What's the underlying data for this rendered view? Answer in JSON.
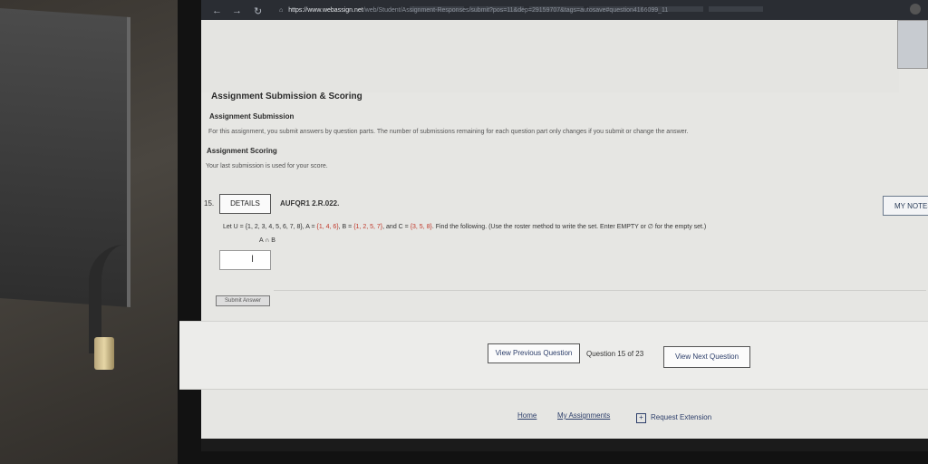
{
  "browser": {
    "url_domain": "https://www.webassign.net",
    "url_rest": "/web/Student/Assignment-Responses/submit?pos=11&dep=29159707&tags=autosave#question4166099_11"
  },
  "scoring": {
    "title": "Assignment Submission & Scoring",
    "submission_heading": "Assignment Submission",
    "submission_text": "For this assignment, you submit answers by question parts. The number of submissions remaining for each question part only changes if you submit or change the answer.",
    "scoring_heading": "Assignment Scoring",
    "scoring_text": "Your last submission is used for your score."
  },
  "question": {
    "number": "15.",
    "details_label": "DETAILS",
    "code": "AUFQR1 2.R.022.",
    "my_notes_label": "MY NOTES",
    "prompt_prefix": "Let U = {1, 2, 3, 4, 5, 6, 7, 8}, A = ",
    "set_a": "{1, 4, 6}",
    "mid1": ", B = ",
    "set_b": "{1, 2, 5, 7}",
    "mid2": ", and C = ",
    "set_c": "{3, 5, 8}",
    "suffix": ". Find the following. (Use the roster method to write the set. Enter EMPTY or ∅ for the empty set.)",
    "expression": "A ∩ B",
    "answer_value": "",
    "submit_label": "Submit Answer"
  },
  "nav": {
    "prev_label": "View Previous Question",
    "count_label": "Question 15 of 23",
    "next_label": "View Next Question"
  },
  "footer": {
    "home": "Home",
    "my_assignments": "My Assignments",
    "request_extension": "Request Extension"
  }
}
